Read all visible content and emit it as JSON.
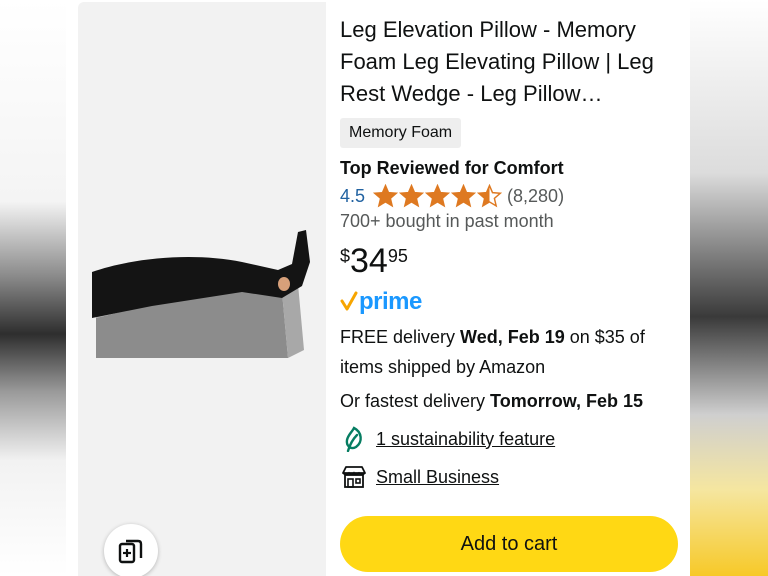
{
  "product": {
    "title": "Leg Elevation Pillow - Memory Foam Leg Elevating Pillow | Leg Rest Wedge - Leg Pillow…",
    "badge": "Memory Foam",
    "highlight": "Top Reviewed for Comfort",
    "rating": "4.5",
    "rating_stars": 4.5,
    "rating_count": "(8,280)",
    "bought": "700+ bought in past month",
    "price": {
      "symbol": "$",
      "whole": "34",
      "fraction": "95"
    },
    "prime_label": "prime",
    "delivery": {
      "free_prefix": "FREE delivery ",
      "free_date": "Wed, Feb 19",
      "free_suffix": " on $35 of items shipped by Amazon",
      "fastest_prefix": "Or fastest delivery ",
      "fastest_date": "Tomorrow, Feb 15"
    },
    "features": [
      {
        "icon": "leaf-icon",
        "label": "1 sustainability feature"
      },
      {
        "icon": "storefront-icon",
        "label": "Small Business"
      }
    ],
    "add_to_cart_label": "Add to cart"
  },
  "colors": {
    "link": "#2162a1",
    "star": "#de7921",
    "button": "#ffd814",
    "prime_blue": "#1a98ff",
    "prime_check": "#f7a500",
    "leaf": "#067d62"
  }
}
